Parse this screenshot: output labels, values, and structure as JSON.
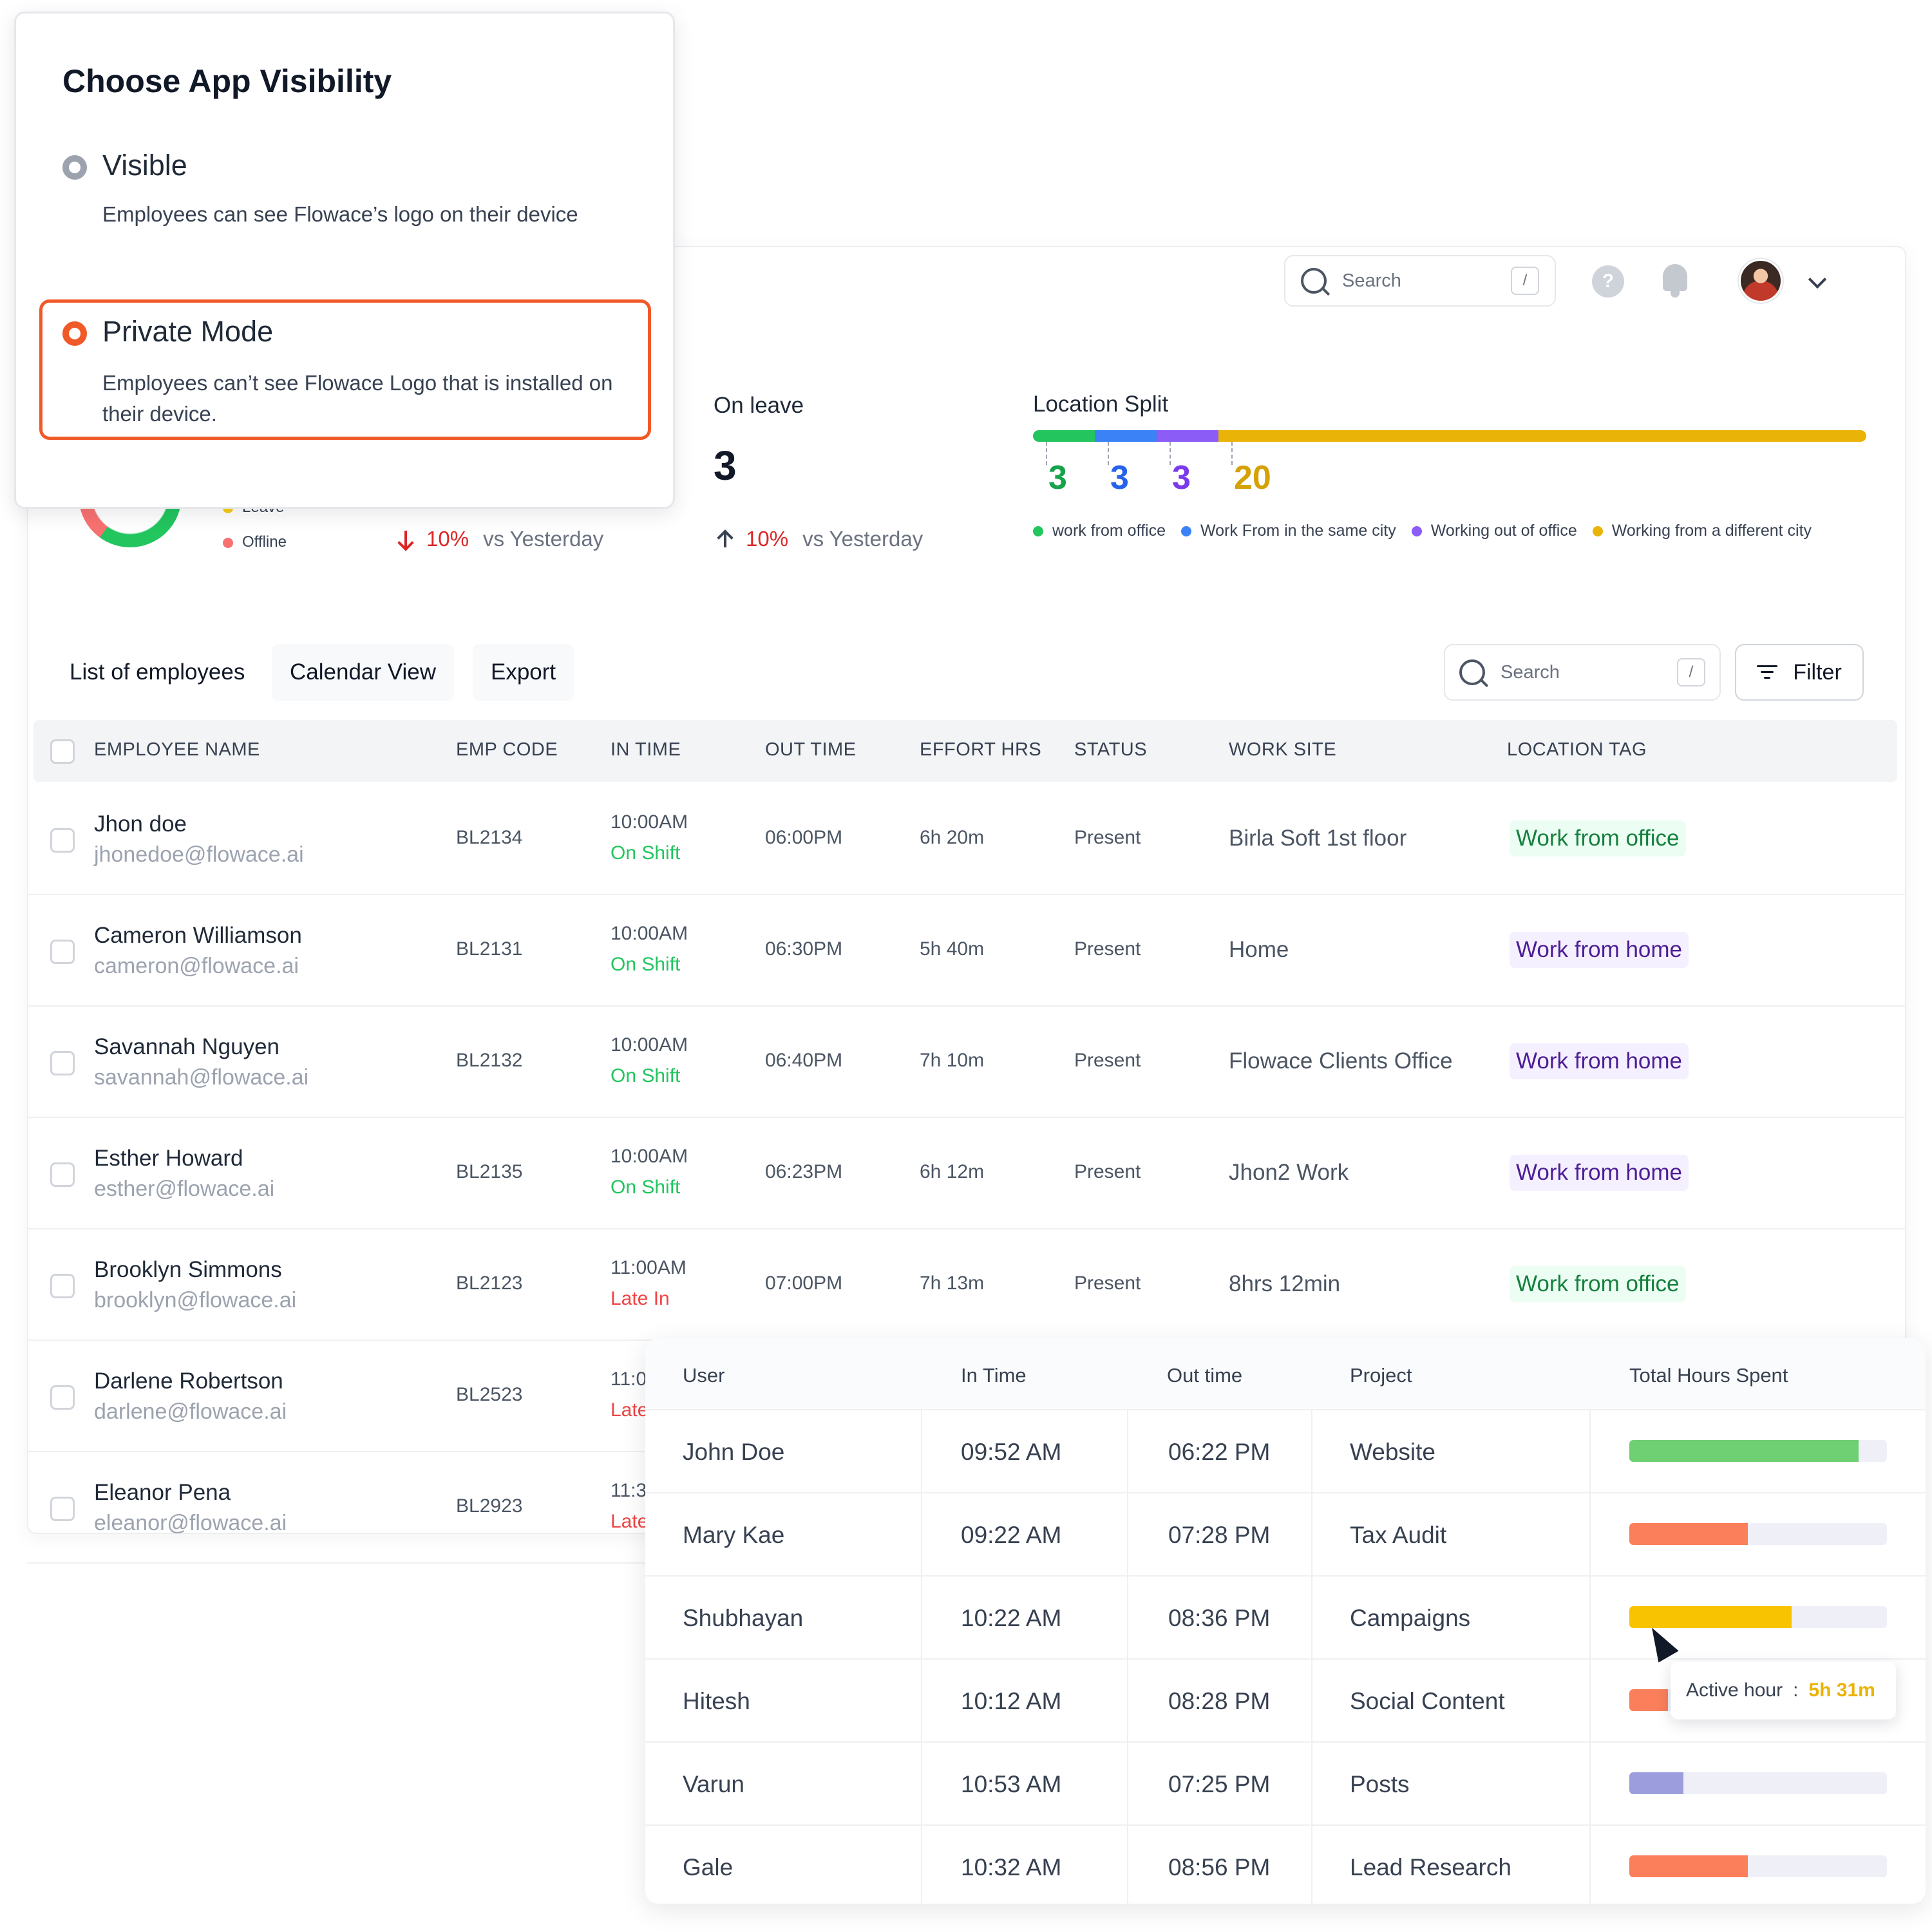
{
  "modal": {
    "title": "Choose App Visibility",
    "options": [
      {
        "label": "Visible",
        "description": "Employees can see Flowace’s logo on their device",
        "selected": false
      },
      {
        "label": "Private Mode",
        "description": "Employees can’t see Flowace Logo that is installed on their device.",
        "selected": true
      }
    ],
    "accent_color": "#f05a28"
  },
  "topbar": {
    "search_placeholder": "Search",
    "search_shortcut": "/",
    "help_icon": "?"
  },
  "stats": {
    "attendance_legend": [
      {
        "label": "Leave",
        "color": "#facc15"
      },
      {
        "label": "Offline",
        "color": "#f87171"
      }
    ],
    "card2_trend": {
      "pct": "10%",
      "text": "vs Yesterday",
      "direction": "down"
    },
    "on_leave": {
      "title": "On leave",
      "value": "3",
      "pct": "10%",
      "text": "vs Yesterday",
      "direction": "up"
    },
    "location_split": {
      "title": "Location Split",
      "segments": [
        {
          "value": "3",
          "label": "work from office",
          "color": "#22c55e",
          "num_color": "#16a34a"
        },
        {
          "value": "3",
          "label": "Work From in the same city",
          "color": "#3b82f6",
          "num_color": "#2563eb"
        },
        {
          "value": "3",
          "label": "Working out of office",
          "color": "#8b5cf6",
          "num_color": "#7c3aed"
        },
        {
          "value": "20",
          "label": "Working from a different city",
          "color": "#eab308",
          "num_color": "#d4a106"
        }
      ]
    }
  },
  "toolbar": {
    "tabs": [
      "List of employees",
      "Calendar View",
      "Export"
    ],
    "search_placeholder": "Search",
    "search_shortcut": "/",
    "filter_label": "Filter"
  },
  "employee_table": {
    "headers": [
      "EMPLOYEE NAME",
      "EMP CODE",
      "IN TIME",
      "OUT TIME",
      "EFFORT HRS",
      "STATUS",
      "WORK SITE",
      "LOCATION TAG"
    ],
    "rows": [
      {
        "name": "Jhon doe",
        "email": "jhonedoe@flowace.ai",
        "code": "BL2134",
        "in_time": "10:00AM",
        "shift": "On Shift",
        "out_time": "06:00PM",
        "effort": "6h 20m",
        "status": "Present",
        "site": "Birla Soft 1st floor",
        "tag": "Work from office"
      },
      {
        "name": "Cameron Williamson",
        "email": "cameron@flowace.ai",
        "code": "BL2131",
        "in_time": "10:00AM",
        "shift": "On Shift",
        "out_time": "06:30PM",
        "effort": "5h 40m",
        "status": "Present",
        "site": "Home",
        "tag": "Work from home"
      },
      {
        "name": "Savannah Nguyen",
        "email": "savannah@flowace.ai",
        "code": "BL2132",
        "in_time": "10:00AM",
        "shift": "On Shift",
        "out_time": "06:40PM",
        "effort": "7h 10m",
        "status": "Present",
        "site": "Flowace Clients Office",
        "tag": "Work from home"
      },
      {
        "name": "Esther Howard",
        "email": "esther@flowace.ai",
        "code": "BL2135",
        "in_time": "10:00AM",
        "shift": "On Shift",
        "out_time": "06:23PM",
        "effort": "6h 12m",
        "status": "Present",
        "site": "Jhon2 Work",
        "tag": "Work from home"
      },
      {
        "name": "Brooklyn Simmons",
        "email": "brooklyn@flowace.ai",
        "code": "BL2123",
        "in_time": "11:00AM",
        "shift": "Late In",
        "out_time": "07:00PM",
        "effort": "7h 13m",
        "status": "Present",
        "site": "8hrs 12min",
        "tag": "Work from office"
      },
      {
        "name": "Darlene Robertson",
        "email": "darlene@flowace.ai",
        "code": "BL2523",
        "in_time": "11:0",
        "shift": "Late",
        "out_time": "",
        "effort": "",
        "status": "",
        "site": "",
        "tag": ""
      },
      {
        "name": "Eleanor Pena",
        "email": "eleanor@flowace.ai",
        "code": "BL2923",
        "in_time": "11:3",
        "shift": "Late",
        "out_time": "",
        "effort": "",
        "status": "",
        "site": "",
        "tag": ""
      }
    ]
  },
  "project_table": {
    "headers": [
      "User",
      "In Time",
      "Out time",
      "Project",
      "Total Hours Spent"
    ],
    "rows": [
      {
        "user": "John Doe",
        "in_time": "09:52 AM",
        "out_time": "06:22 PM",
        "project": "Website",
        "progress": 0.89,
        "color": "#6fcf73"
      },
      {
        "user": "Mary Kae",
        "in_time": "09:22 AM",
        "out_time": "07:28 PM",
        "project": "Tax Audit",
        "progress": 0.46,
        "color": "#fa7f5a"
      },
      {
        "user": "Shubhayan",
        "in_time": "10:22 AM",
        "out_time": "08:36 PM",
        "project": "Campaigns",
        "progress": 0.63,
        "color": "#f8c300"
      },
      {
        "user": "Hitesh",
        "in_time": "10:12 AM",
        "out_time": "08:28 PM",
        "project": "Social Content",
        "progress": 0.15,
        "color": "#fa7f5a"
      },
      {
        "user": "Varun",
        "in_time": "10:53 AM",
        "out_time": "07:25 PM",
        "project": "Posts",
        "progress": 0.21,
        "color": "#9b9ddc"
      },
      {
        "user": "Gale",
        "in_time": "10:32 AM",
        "out_time": "08:56 PM",
        "project": "Lead Research",
        "progress": 0.46,
        "color": "#fa7f5a"
      }
    ],
    "tooltip": {
      "label": "Active hour",
      "separator": ":",
      "value": "5h 31m"
    }
  }
}
